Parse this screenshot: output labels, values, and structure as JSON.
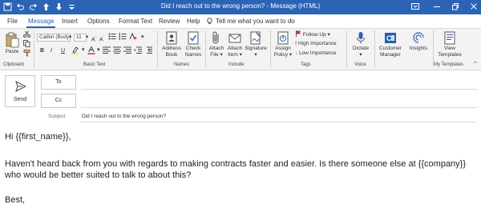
{
  "window": {
    "title": "Did I reach out to the wrong person? - Message (HTML)"
  },
  "tabs": [
    {
      "label": "File"
    },
    {
      "label": "Message"
    },
    {
      "label": "Insert"
    },
    {
      "label": "Options"
    },
    {
      "label": "Format Text"
    },
    {
      "label": "Review"
    },
    {
      "label": "Help"
    }
  ],
  "tell_me": "Tell me what you want to do",
  "ribbon": {
    "clipboard": {
      "paste": "Paste",
      "label": "Clipboard"
    },
    "basic_text": {
      "font_name": "Calibri (Body",
      "font_size": "11",
      "bold": "B",
      "italic": "I",
      "underline": "U",
      "label": "Basic Text"
    },
    "names": {
      "address_book_1": "Address",
      "address_book_2": "Book",
      "check_names_1": "Check",
      "check_names_2": "Names",
      "label": "Names"
    },
    "include": {
      "attach_file_1": "Attach",
      "attach_file_2": "File ▾",
      "attach_item_1": "Attach",
      "attach_item_2": "Item ▾",
      "signature_1": "Signature",
      "signature_2": "▾",
      "label": "Include"
    },
    "tags": {
      "assign_policy_1": "Assign",
      "assign_policy_2": "Policy ▾",
      "follow_up": "Follow Up ▾",
      "high_importance": "High Importance",
      "low_importance": "Low Importance",
      "label": "Tags"
    },
    "voice": {
      "dictate": "Dictate",
      "dictate_2": "▾",
      "label": "Voice"
    },
    "customer_manager": {
      "line1": "Customer",
      "line2": "Manager"
    },
    "insights": {
      "label": "Insights"
    },
    "my_templates": {
      "view_1": "View",
      "view_2": "Templates",
      "label": "My Templates"
    }
  },
  "compose": {
    "send": "Send",
    "to": "To",
    "cc": "Cc",
    "subject_label": "Subject",
    "subject_value": "Did I reach out to the wrong person?"
  },
  "body": {
    "greeting": "Hi {{first_name}},",
    "main": "Haven't heard back from you with regards to making contracts faster and easier. Is there someone else at {{company}} who would be better suited to talk to about this?",
    "signoff": "Best,"
  },
  "colors": {
    "accent": "#2b64b5",
    "follow_up_flag": "#d13438",
    "high_importance": "#d13438",
    "low_importance": "#2b64b5"
  }
}
